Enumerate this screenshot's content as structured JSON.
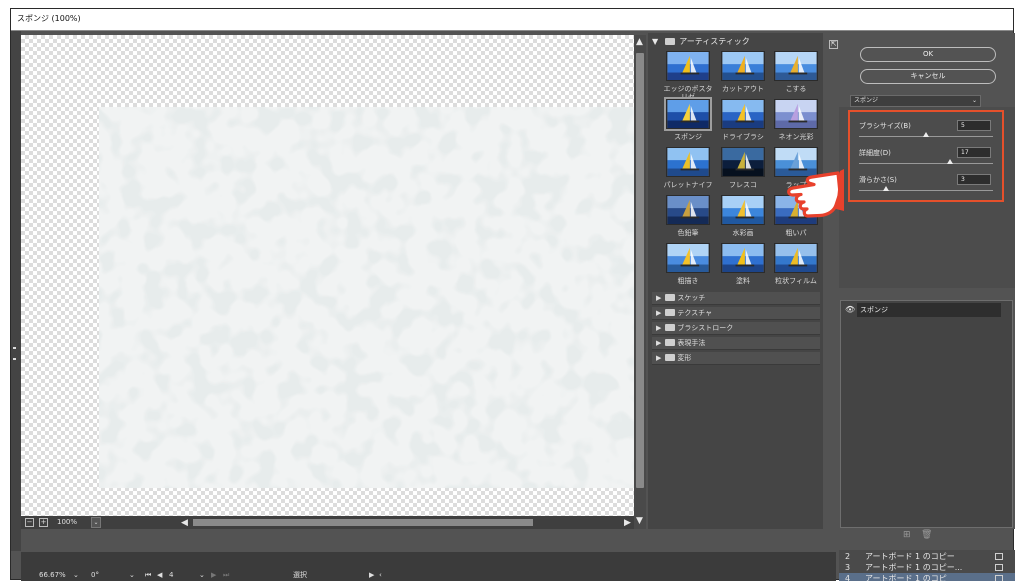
{
  "window": {
    "title": "スポンジ (100%)"
  },
  "preview": {
    "zoom": "100%"
  },
  "gallery": {
    "open_category": "アーティスティック",
    "filters": [
      {
        "label": "エッジのポスタリゼ\nーション",
        "selected": false
      },
      {
        "label": "カットアウト",
        "selected": false
      },
      {
        "label": "こする",
        "selected": false
      },
      {
        "label": "スポンジ",
        "selected": true
      },
      {
        "label": "ドライブラシ",
        "selected": false
      },
      {
        "label": "ネオン光彩",
        "selected": false
      },
      {
        "label": "パレットナイフ",
        "selected": false
      },
      {
        "label": "フレスコ",
        "selected": false
      },
      {
        "label": "ラップ",
        "selected": false
      },
      {
        "label": "色鉛筆",
        "selected": false
      },
      {
        "label": "水彩画",
        "selected": false
      },
      {
        "label": "粗いパ",
        "selected": false
      },
      {
        "label": "粗描き",
        "selected": false
      },
      {
        "label": "塗料",
        "selected": false
      },
      {
        "label": "粒状フィルム",
        "selected": false
      }
    ],
    "categories": [
      "スケッチ",
      "テクスチャ",
      "ブラシストローク",
      "表現手法",
      "変形"
    ]
  },
  "buttons": {
    "ok": "OK",
    "cancel": "キャンセル"
  },
  "filter_select": {
    "value": "スポンジ"
  },
  "params": [
    {
      "label": "ブラシサイズ(B)",
      "value": "5",
      "fraction": 0.5
    },
    {
      "label": "詳細度(D)",
      "value": "17",
      "fraction": 0.68
    },
    {
      "label": "滑らかさ(S)",
      "value": "3",
      "fraction": 0.2
    }
  ],
  "layers": [
    {
      "name": "スポンジ",
      "visible": true
    }
  ],
  "status": {
    "zoom": "66.67%",
    "angle": "0°",
    "page": "4",
    "tool": "選択"
  },
  "artboards": [
    {
      "num": "2",
      "name": "アートボード 1 のコピー"
    },
    {
      "num": "3",
      "name": "アートボード 1 のコピー..."
    },
    {
      "num": "4",
      "name": "アートボード 1 のコピ"
    }
  ],
  "colors": {
    "highlight": "#e5502b",
    "hand": "#e8412c",
    "panel": "#535353"
  },
  "icons": {
    "collapse": "collapse-icon",
    "new_layer": "new-layer-icon",
    "delete_layer": "trash-icon",
    "eye": "eye-icon"
  }
}
